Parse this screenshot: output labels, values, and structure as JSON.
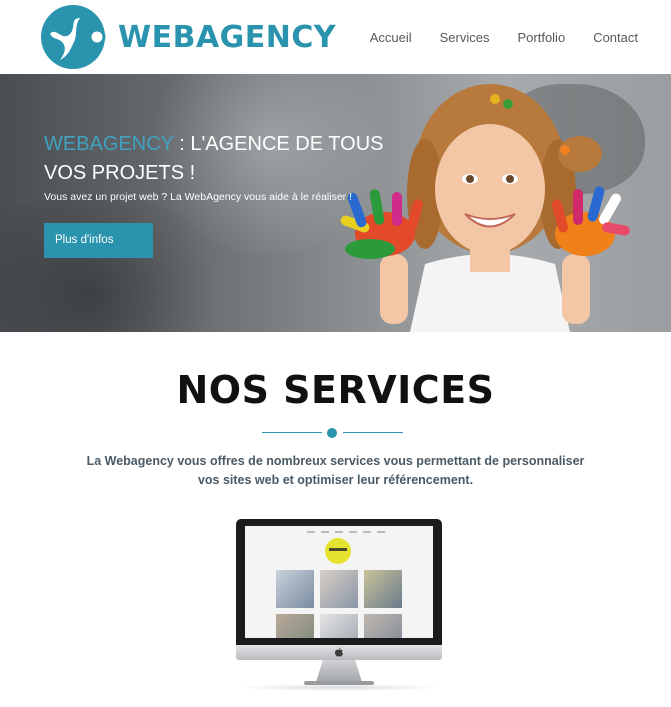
{
  "header": {
    "logo_text": "WEBAGENCY",
    "nav": [
      "Accueil",
      "Services",
      "Portfolio",
      "Contact"
    ]
  },
  "hero": {
    "title_brand": "WEBAGENCY",
    "title_rest": " : L'AGENCE DE TOUS VOS PROJETS !",
    "subtitle": "Vous avez un projet web ? La WebAgency vous aide à le réaliser !",
    "button_label": "Plus d'infos"
  },
  "services": {
    "title": "NOS SERVICES",
    "description": "La Webagency vous offres de nombreux services vous permettant de personnaliser vos sites web et optimiser leur référencement."
  },
  "colors": {
    "accent": "#2a93ad",
    "title": "#111111",
    "body_text": "#4a5a66"
  },
  "icons": [
    "logo-mark-icon",
    "apple-icon"
  ]
}
